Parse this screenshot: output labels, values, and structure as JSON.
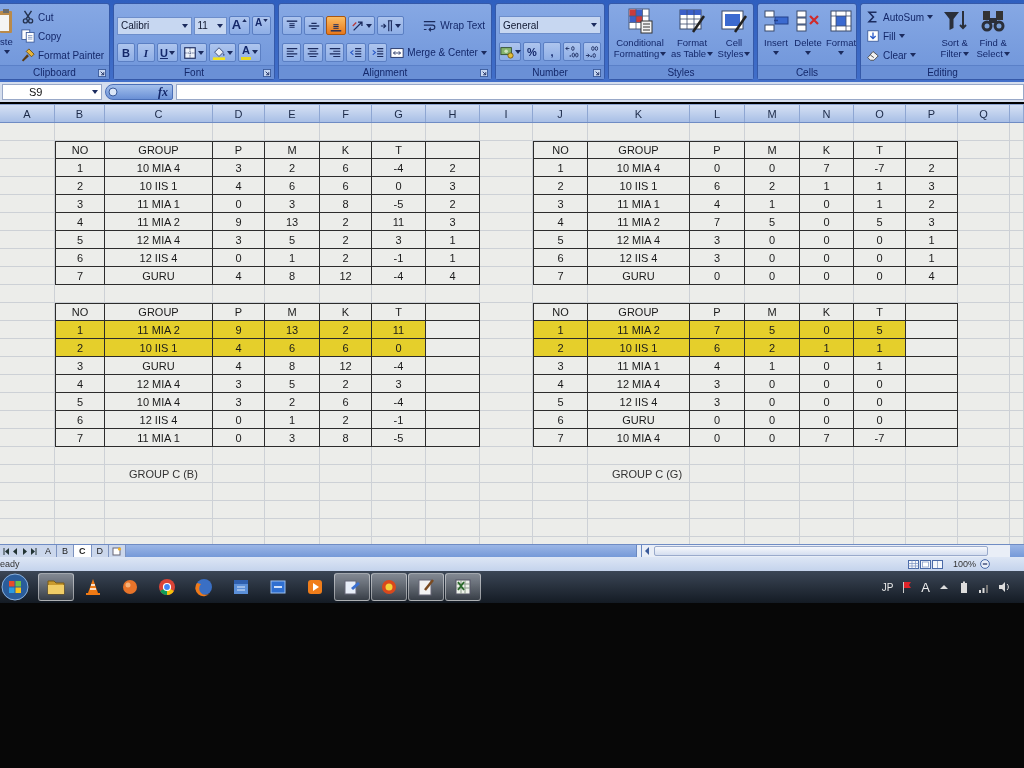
{
  "ribbon": {
    "groups": [
      {
        "kind": "clipboard",
        "label": "Clipboard",
        "launcher": true,
        "items": [
          {
            "kind": "paste",
            "label": "ste",
            "dropdown": true
          }
        ],
        "stack": [
          {
            "kind": "cut",
            "label": "Cut"
          },
          {
            "kind": "copy",
            "label": "Copy"
          },
          {
            "kind": "format_painter",
            "label": "Format Painter"
          }
        ]
      },
      {
        "kind": "font",
        "label": "Font",
        "launcher": true,
        "upper": [
          {
            "kind": "font_name",
            "value": "Calibri"
          },
          {
            "kind": "font_size",
            "value": "11"
          },
          {
            "kind": "grow_font",
            "label": "A"
          },
          {
            "kind": "shrink_font",
            "label": "A"
          }
        ],
        "lower": [
          {
            "kind": "bold",
            "label": "B"
          },
          {
            "kind": "italic",
            "label": "I"
          },
          {
            "kind": "underline",
            "label": "U",
            "dropdown": true
          },
          {
            "kind": "borders",
            "dropdown": true
          },
          {
            "kind": "fill_color",
            "dropdown": true
          },
          {
            "kind": "font_color",
            "label": "A",
            "dropdown": true
          }
        ]
      },
      {
        "kind": "alignment",
        "label": "Alignment",
        "launcher": true,
        "upper": [
          {
            "kind": "align_top",
            "selected": false
          },
          {
            "kind": "align_middle",
            "selected": false
          },
          {
            "kind": "align_bottom",
            "selected": true
          },
          {
            "kind": "orientation",
            "dropdown": true,
            "selected": false
          },
          {
            "kind": "text_direction",
            "dropdown": true,
            "selected": false
          },
          {
            "kind": "wrap_text",
            "label": "Wrap Text",
            "selected": false
          }
        ],
        "lower": [
          {
            "kind": "align_left",
            "selected": false
          },
          {
            "kind": "align_center",
            "selected": false
          },
          {
            "kind": "align_right",
            "selected": false
          },
          {
            "kind": "decrease_indent",
            "selected": false
          },
          {
            "kind": "increase_indent",
            "selected": false
          },
          {
            "kind": "merge_center",
            "label": "Merge & Center",
            "dropdown": true,
            "selected": false
          }
        ]
      },
      {
        "kind": "number",
        "label": "Number",
        "launcher": true,
        "upper": [
          {
            "kind": "number_format",
            "value": "General"
          }
        ],
        "lower": [
          {
            "kind": "accounting",
            "dropdown": true
          },
          {
            "kind": "percent",
            "label": "%"
          },
          {
            "kind": "comma",
            "label": ","
          },
          {
            "kind": "increase_decimal"
          },
          {
            "kind": "decrease_decimal"
          }
        ]
      },
      {
        "kind": "styles",
        "label": "Styles",
        "items": [
          {
            "kind": "conditional_formatting",
            "label": "Conditional Formatting",
            "dropdown": true
          },
          {
            "kind": "format_as_table",
            "label": "Format as Table",
            "dropdown": true
          },
          {
            "kind": "cell_styles",
            "label": "Cell Styles",
            "dropdown": true
          }
        ]
      },
      {
        "kind": "cells",
        "label": "Cells",
        "items": [
          {
            "kind": "insert",
            "label": "Insert",
            "dropdown": true
          },
          {
            "kind": "delete",
            "label": "Delete",
            "dropdown": true
          },
          {
            "kind": "format",
            "label": "Format",
            "dropdown": true
          }
        ]
      },
      {
        "kind": "editing",
        "label": "Editing",
        "stack": [
          {
            "kind": "autosum",
            "label": "AutoSum",
            "dropdown": true
          },
          {
            "kind": "fill",
            "label": "Fill",
            "dropdown": true
          },
          {
            "kind": "clear",
            "label": "Clear",
            "dropdown": true
          }
        ],
        "items": [
          {
            "kind": "sort_filter",
            "label": "Sort & Filter",
            "dropdown": true
          },
          {
            "kind": "find_select",
            "label": "Find & Select",
            "dropdown": true
          }
        ]
      }
    ]
  },
  "formula_bar": {
    "name_box": "S9",
    "function_label": "fx"
  },
  "sheet": {
    "columns": [
      "A",
      "B",
      "C",
      "D",
      "E",
      "F",
      "G",
      "H",
      "I",
      "J",
      "K",
      "L",
      "M",
      "N",
      "O",
      "P",
      "Q"
    ],
    "tables": [
      {
        "columns": [
          "NO",
          "GROUP",
          "P",
          "M",
          "K",
          "T"
        ],
        "rows": [
          {
            "cells": [
              "1",
              "10 MIA 4",
              "3",
              "2",
              "6",
              "-4",
              "2"
            ],
            "highlighted": false
          },
          {
            "cells": [
              "2",
              "10 IIS 1",
              "4",
              "6",
              "6",
              "0",
              "3"
            ],
            "highlighted": false
          },
          {
            "cells": [
              "3",
              "11 MIA 1",
              "0",
              "3",
              "8",
              "-5",
              "2"
            ],
            "highlighted": false
          },
          {
            "cells": [
              "4",
              "11 MIA 2",
              "9",
              "13",
              "2",
              "11",
              "3"
            ],
            "highlighted": false
          },
          {
            "cells": [
              "5",
              "12 MIA 4",
              "3",
              "5",
              "2",
              "3",
              "1"
            ],
            "highlighted": false
          },
          {
            "cells": [
              "6",
              "12 IIS 4",
              "0",
              "1",
              "2",
              "-1",
              "1"
            ],
            "highlighted": false
          },
          {
            "cells": [
              "7",
              "GURU",
              "4",
              "8",
              "12",
              "-4",
              "4"
            ],
            "highlighted": false
          }
        ]
      },
      {
        "columns": [
          "NO",
          "GROUP",
          "P",
          "M",
          "K",
          "T"
        ],
        "rows": [
          {
            "cells": [
              "1",
              "10 MIA 4",
              "0",
              "0",
              "7",
              "-7",
              "2"
            ],
            "highlighted": false
          },
          {
            "cells": [
              "2",
              "10 IIS 1",
              "6",
              "2",
              "1",
              "1",
              "3"
            ],
            "highlighted": false
          },
          {
            "cells": [
              "3",
              "11 MIA 1",
              "4",
              "1",
              "0",
              "1",
              "2"
            ],
            "highlighted": false
          },
          {
            "cells": [
              "4",
              "11 MIA 2",
              "7",
              "5",
              "0",
              "5",
              "3"
            ],
            "highlighted": false
          },
          {
            "cells": [
              "5",
              "12 MIA 4",
              "3",
              "0",
              "0",
              "0",
              "1"
            ],
            "highlighted": false
          },
          {
            "cells": [
              "6",
              "12 IIS 4",
              "3",
              "0",
              "0",
              "0",
              "1"
            ],
            "highlighted": false
          },
          {
            "cells": [
              "7",
              "GURU",
              "0",
              "0",
              "0",
              "0",
              "4"
            ],
            "highlighted": false
          }
        ]
      },
      {
        "columns": [
          "NO",
          "GROUP",
          "P",
          "M",
          "K",
          "T"
        ],
        "rows": [
          {
            "cells": [
              "1",
              "11 MIA 2",
              "9",
              "13",
              "2",
              "11"
            ],
            "highlighted": true
          },
          {
            "cells": [
              "2",
              "10 IIS 1",
              "4",
              "6",
              "6",
              "0"
            ],
            "highlighted": true
          },
          {
            "cells": [
              "3",
              "GURU",
              "4",
              "8",
              "12",
              "-4"
            ],
            "highlighted": false
          },
          {
            "cells": [
              "4",
              "12 MIA 4",
              "3",
              "5",
              "2",
              "3"
            ],
            "highlighted": false
          },
          {
            "cells": [
              "5",
              "10 MIA 4",
              "3",
              "2",
              "6",
              "-4"
            ],
            "highlighted": false
          },
          {
            "cells": [
              "6",
              "12 IIS 4",
              "0",
              "1",
              "2",
              "-1"
            ],
            "highlighted": false
          },
          {
            "cells": [
              "7",
              "11 MIA 1",
              "0",
              "3",
              "8",
              "-5"
            ],
            "highlighted": false
          }
        ],
        "caption": "GROUP C (B)"
      },
      {
        "columns": [
          "NO",
          "GROUP",
          "P",
          "M",
          "K",
          "T"
        ],
        "rows": [
          {
            "cells": [
              "1",
              "11 MIA 2",
              "7",
              "5",
              "0",
              "5"
            ],
            "highlighted": true
          },
          {
            "cells": [
              "2",
              "10 IIS 1",
              "6",
              "2",
              "1",
              "1"
            ],
            "highlighted": true
          },
          {
            "cells": [
              "3",
              "11 MIA 1",
              "4",
              "1",
              "0",
              "1"
            ],
            "highlighted": false
          },
          {
            "cells": [
              "4",
              "12 MIA 4",
              "3",
              "0",
              "0",
              "0"
            ],
            "highlighted": false
          },
          {
            "cells": [
              "5",
              "12 IIS 4",
              "3",
              "0",
              "0",
              "0"
            ],
            "highlighted": false
          },
          {
            "cells": [
              "6",
              "GURU",
              "0",
              "0",
              "0",
              "0"
            ],
            "highlighted": false
          },
          {
            "cells": [
              "7",
              "10 MIA 4",
              "0",
              "0",
              "7",
              "-7"
            ],
            "highlighted": false
          }
        ],
        "caption": "GROUP C (G)"
      }
    ]
  },
  "sheet_tabs": [
    {
      "label": "A",
      "selected": false
    },
    {
      "label": "B",
      "selected": false
    },
    {
      "label": "C",
      "selected": true
    },
    {
      "label": "D",
      "selected": false
    }
  ],
  "status_bar": {
    "text": "eady",
    "zoom": "100%"
  },
  "taskbar": {
    "apps": [
      {
        "kind": "folder",
        "running": true
      },
      {
        "kind": "cone",
        "running": false
      },
      {
        "kind": "ball",
        "running": false
      },
      {
        "kind": "wheel",
        "running": false
      },
      {
        "kind": "globe",
        "running": false
      },
      {
        "kind": "calendar",
        "running": false
      },
      {
        "kind": "tile",
        "running": false
      },
      {
        "kind": "play",
        "running": false
      },
      {
        "kind": "tools",
        "running": true
      },
      {
        "kind": "ring",
        "running": true
      },
      {
        "kind": "brush",
        "running": true
      },
      {
        "kind": "spreadsheet",
        "running": true
      }
    ],
    "tray": {
      "language": "JP",
      "ime": "A"
    }
  }
}
